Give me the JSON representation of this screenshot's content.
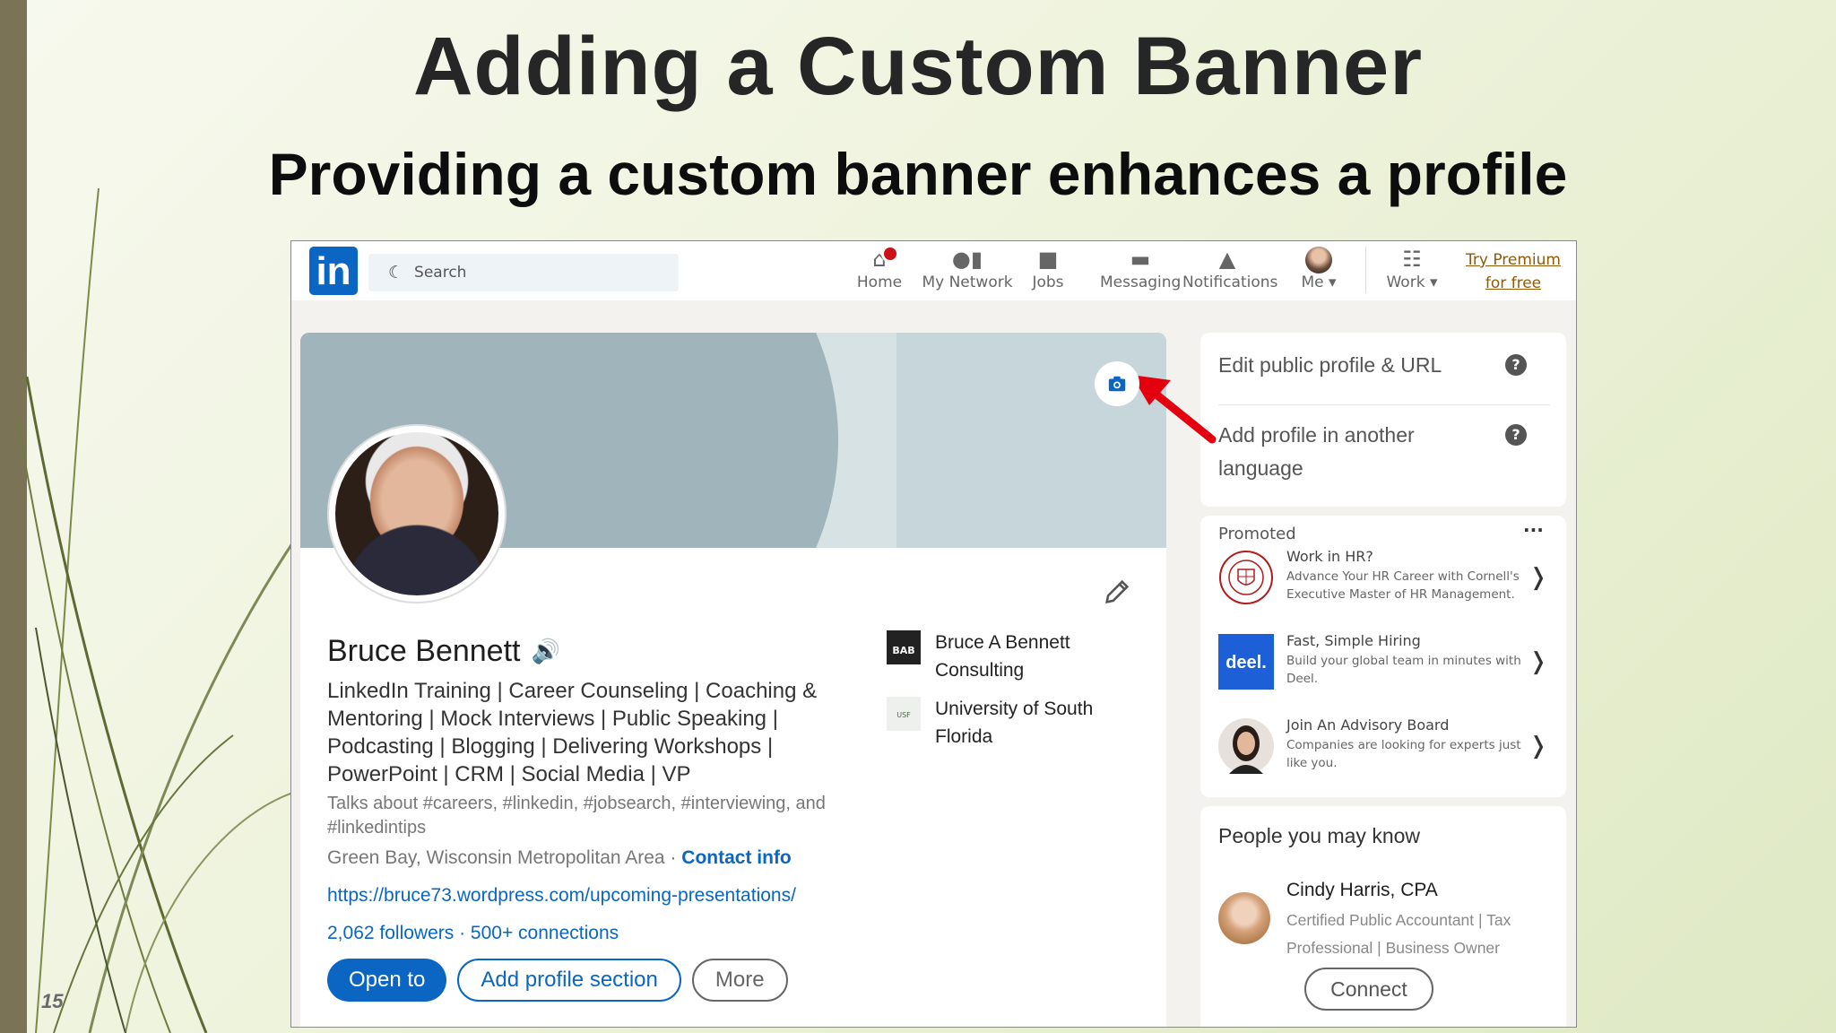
{
  "slide": {
    "title": "Adding a Custom Banner",
    "subtitle": "Providing a custom banner enhances a profile",
    "number": "15"
  },
  "nav": {
    "search_placeholder": "Search",
    "items": [
      {
        "label": "Home",
        "icon": "home-icon"
      },
      {
        "label": "My Network",
        "icon": "network-icon"
      },
      {
        "label": "Jobs",
        "icon": "briefcase-icon"
      },
      {
        "label": "Messaging",
        "icon": "chat-icon"
      },
      {
        "label": "Notifications",
        "icon": "bell-icon"
      },
      {
        "label": "Me",
        "icon": "avatar-icon"
      },
      {
        "label": "Work",
        "icon": "grid-icon"
      }
    ],
    "premium_line1": "Try Premium",
    "premium_line2": "for free"
  },
  "profile": {
    "name": "Bruce Bennett",
    "headline": "LinkedIn Training | Career Counseling | Coaching & Mentoring | Mock Interviews | Public Speaking | Podcasting | Blogging | Delivering Workshops | PowerPoint | CRM | Social Media | VP",
    "talks_about": "Talks about #careers, #linkedin, #jobsearch, #interviewing, and #linkedintips",
    "location": "Green Bay, Wisconsin Metropolitan Area · ",
    "contact_info": "Contact info",
    "website": "https://bruce73.wordpress.com/upcoming-presentations/",
    "followers": "2,062 followers",
    "connections": "· 500+ connections",
    "buttons": {
      "open_to": "Open to",
      "add_section": "Add profile section",
      "more": "More"
    },
    "orgs": [
      {
        "name": "Bruce A Bennett Consulting",
        "logo_text": "BAB"
      },
      {
        "name": "University of South Florida",
        "logo_text": "USF"
      }
    ]
  },
  "sidebar": {
    "edit_public_profile": "Edit public profile & URL",
    "add_language": "Add profile in another language",
    "promoted_label": "Promoted",
    "ads": [
      {
        "title": "Work in HR?",
        "desc": "Advance Your HR Career with Cornell's Executive Master of HR Management."
      },
      {
        "title": "Fast, Simple Hiring",
        "desc": "Build your global team in minutes with Deel.",
        "logo_text": "deel."
      },
      {
        "title": "Join An Advisory Board",
        "desc": "Companies are looking for experts just like you."
      }
    ],
    "pymk_title": "People you may know",
    "person": {
      "name": "Cindy Harris, CPA",
      "desc": "Certified Public Accountant | Tax Professional | Business Owner",
      "connect": "Connect"
    }
  },
  "colors": {
    "linkedin_blue": "#0a66c2",
    "banner": "#a0b4bb",
    "arrow": "#e3000f",
    "slide_bar": "#7b7355"
  }
}
